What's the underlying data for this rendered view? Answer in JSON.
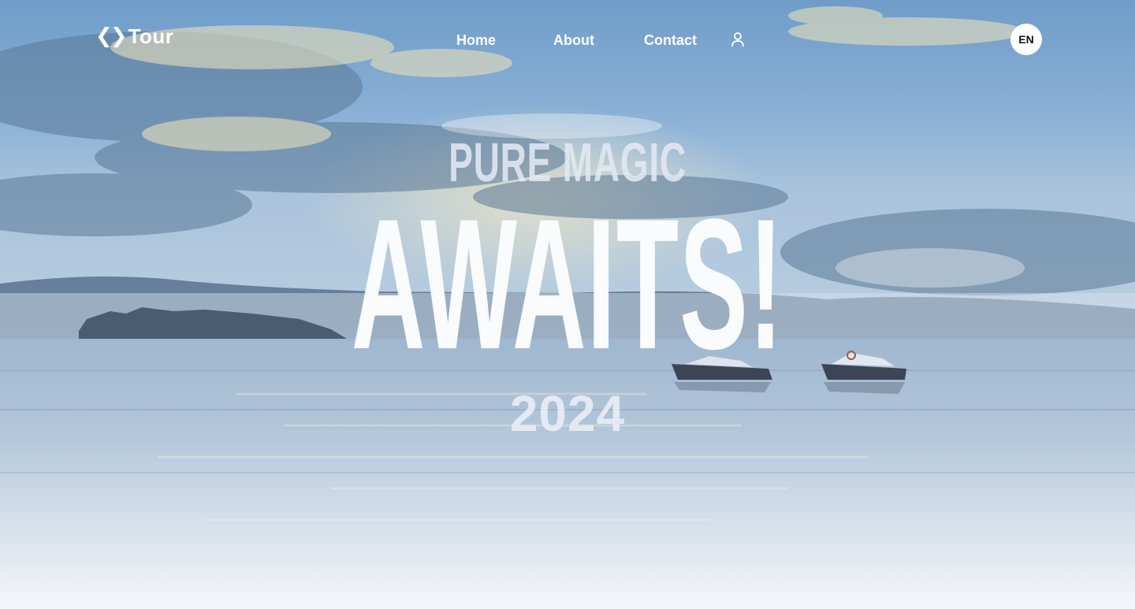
{
  "header": {
    "logo_mark": "❮❯",
    "logo_text": "Tour",
    "nav": [
      {
        "label": "Home"
      },
      {
        "label": "About"
      },
      {
        "label": "Contact"
      }
    ],
    "user_icon": "user-icon",
    "language_label": "EN"
  },
  "hero": {
    "subtitle": "PURE MAGIC",
    "headline": "AWAITS!",
    "year": "2024",
    "background": "lake with misty hills, clouds and two motorboats",
    "colors": {
      "sky": "#7ea7cf",
      "water": "#b3c8dc",
      "text": "#ffffff"
    }
  }
}
